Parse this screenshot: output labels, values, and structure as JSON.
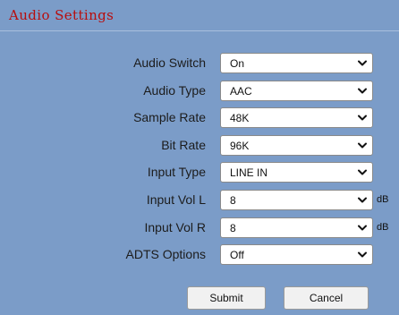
{
  "panel": {
    "title": "Audio Settings"
  },
  "fields": [
    {
      "label": "Audio Switch",
      "value": "On"
    },
    {
      "label": "Audio Type",
      "value": "AAC"
    },
    {
      "label": "Sample Rate",
      "value": "48K"
    },
    {
      "label": "Bit Rate",
      "value": "96K"
    },
    {
      "label": "Input Type",
      "value": "LINE IN"
    },
    {
      "label": "Input Vol L",
      "value": "8",
      "unit": "dB"
    },
    {
      "label": "Input Vol R",
      "value": "8",
      "unit": "dB"
    },
    {
      "label": "ADTS Options",
      "value": "Off"
    }
  ],
  "buttons": {
    "submit_label": "Submit",
    "cancel_label": "Cancel"
  },
  "icons": {
    "dropdown": "chevron-down-icon"
  },
  "colors": {
    "panel_background": "#7b9cc8",
    "title_text": "#b80d0d"
  }
}
